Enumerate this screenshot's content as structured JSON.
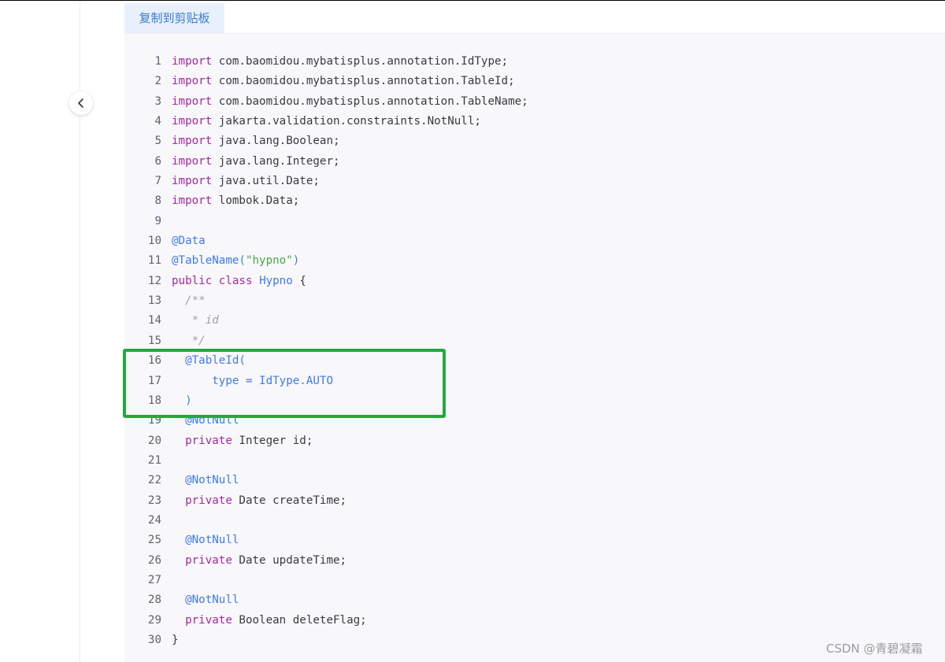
{
  "toolbar": {
    "copy_label": "复制到剪贴板"
  },
  "watermark": "CSDN @青碧凝霜",
  "icons": {
    "back": "chevron-left-icon"
  },
  "colors": {
    "keyword": "#a626a4",
    "annotation": "#4078f2",
    "string": "#50a14f",
    "comment": "#a0a1a7",
    "highlight": "#22aa3c"
  },
  "code": {
    "lines": [
      {
        "n": "1",
        "tokens": [
          {
            "t": "import",
            "c": "kw"
          },
          {
            "t": " com.baomidou.mybatisplus.annotation.IdType;"
          }
        ]
      },
      {
        "n": "2",
        "tokens": [
          {
            "t": "import",
            "c": "kw"
          },
          {
            "t": " com.baomidou.mybatisplus.annotation.TableId;"
          }
        ]
      },
      {
        "n": "3",
        "tokens": [
          {
            "t": "import",
            "c": "kw"
          },
          {
            "t": " com.baomidou.mybatisplus.annotation.TableName;"
          }
        ]
      },
      {
        "n": "4",
        "tokens": [
          {
            "t": "import",
            "c": "kw"
          },
          {
            "t": " jakarta.validation.constraints.NotNull;"
          }
        ]
      },
      {
        "n": "5",
        "tokens": [
          {
            "t": "import",
            "c": "kw"
          },
          {
            "t": " java.lang.Boolean;"
          }
        ]
      },
      {
        "n": "6",
        "tokens": [
          {
            "t": "import",
            "c": "kw"
          },
          {
            "t": " java.lang.Integer;"
          }
        ]
      },
      {
        "n": "7",
        "tokens": [
          {
            "t": "import",
            "c": "kw"
          },
          {
            "t": " java.util.Date;"
          }
        ]
      },
      {
        "n": "8",
        "tokens": [
          {
            "t": "import",
            "c": "kw"
          },
          {
            "t": " lombok.Data;"
          }
        ]
      },
      {
        "n": "9",
        "tokens": []
      },
      {
        "n": "10",
        "tokens": [
          {
            "t": "@Data",
            "c": "ann"
          }
        ]
      },
      {
        "n": "11",
        "tokens": [
          {
            "t": "@TableName(",
            "c": "ann"
          },
          {
            "t": "\"hypno\"",
            "c": "str"
          },
          {
            "t": ")",
            "c": "ann"
          }
        ]
      },
      {
        "n": "12",
        "tokens": [
          {
            "t": "public",
            "c": "kw"
          },
          {
            "t": " "
          },
          {
            "t": "class",
            "c": "kw"
          },
          {
            "t": " "
          },
          {
            "t": "Hypno",
            "c": "cls"
          },
          {
            "t": " {"
          }
        ]
      },
      {
        "n": "13",
        "tokens": [
          {
            "t": "  /**",
            "c": "cm"
          }
        ]
      },
      {
        "n": "14",
        "tokens": [
          {
            "t": "   * id",
            "c": "cm"
          }
        ]
      },
      {
        "n": "15",
        "tokens": [
          {
            "t": "   */",
            "c": "cm"
          }
        ]
      },
      {
        "n": "16",
        "tokens": [
          {
            "t": "  "
          },
          {
            "t": "@TableId(",
            "c": "ann"
          }
        ]
      },
      {
        "n": "17",
        "tokens": [
          {
            "t": "      type = IdType.AUTO",
            "c": "ann"
          }
        ]
      },
      {
        "n": "18",
        "tokens": [
          {
            "t": "  "
          },
          {
            "t": ")",
            "c": "ann"
          }
        ]
      },
      {
        "n": "19",
        "tokens": [
          {
            "t": "  "
          },
          {
            "t": "@NotNull",
            "c": "ann"
          }
        ]
      },
      {
        "n": "20",
        "tokens": [
          {
            "t": "  "
          },
          {
            "t": "private",
            "c": "kw"
          },
          {
            "t": " Integer id;"
          }
        ]
      },
      {
        "n": "21",
        "tokens": []
      },
      {
        "n": "22",
        "tokens": [
          {
            "t": "  "
          },
          {
            "t": "@NotNull",
            "c": "ann"
          }
        ]
      },
      {
        "n": "23",
        "tokens": [
          {
            "t": "  "
          },
          {
            "t": "private",
            "c": "kw"
          },
          {
            "t": " Date createTime;"
          }
        ]
      },
      {
        "n": "24",
        "tokens": []
      },
      {
        "n": "25",
        "tokens": [
          {
            "t": "  "
          },
          {
            "t": "@NotNull",
            "c": "ann"
          }
        ]
      },
      {
        "n": "26",
        "tokens": [
          {
            "t": "  "
          },
          {
            "t": "private",
            "c": "kw"
          },
          {
            "t": " Date updateTime;"
          }
        ]
      },
      {
        "n": "27",
        "tokens": []
      },
      {
        "n": "28",
        "tokens": [
          {
            "t": "  "
          },
          {
            "t": "@NotNull",
            "c": "ann"
          }
        ]
      },
      {
        "n": "29",
        "tokens": [
          {
            "t": "  "
          },
          {
            "t": "private",
            "c": "kw"
          },
          {
            "t": " Boolean deleteFlag;"
          }
        ]
      },
      {
        "n": "30",
        "tokens": [
          {
            "t": "}"
          }
        ]
      }
    ]
  }
}
